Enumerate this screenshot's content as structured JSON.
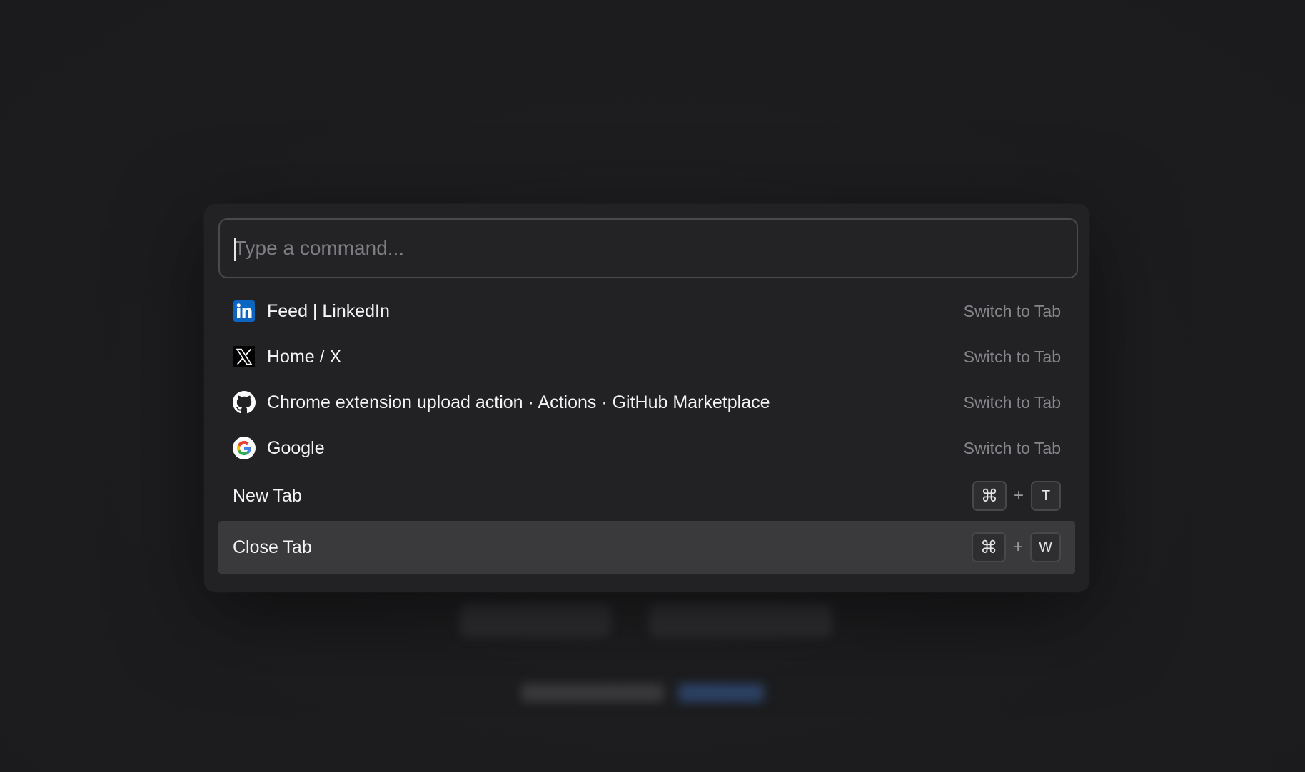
{
  "command_input": {
    "placeholder": "Type a command...",
    "value": ""
  },
  "tabs": [
    {
      "icon": "linkedin-icon",
      "title": "Feed | LinkedIn",
      "action": "Switch to Tab"
    },
    {
      "icon": "x-logo-icon",
      "title": "Home / X",
      "action": "Switch to Tab"
    },
    {
      "icon": "github-icon",
      "title": "Chrome extension upload action · Actions · GitHub Marketplace",
      "action": "Switch to Tab"
    },
    {
      "icon": "google-icon",
      "title": "Google",
      "action": "Switch to Tab"
    }
  ],
  "actions": [
    {
      "label": "New Tab",
      "keys": [
        "⌘",
        "+",
        "T"
      ],
      "selected": false
    },
    {
      "label": "Close Tab",
      "keys": [
        "⌘",
        "+",
        "W"
      ],
      "selected": true
    }
  ],
  "colors": {
    "background": "#1c1c1e",
    "palette": "#222224",
    "selected_row": "#3a3a3c",
    "hint_text": "#86868b",
    "linkedin_blue": "#0a66c2"
  }
}
